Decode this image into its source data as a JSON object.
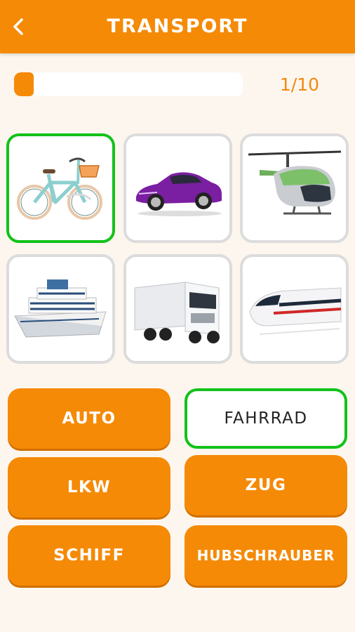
{
  "header": {
    "title": "TRANSPORT",
    "back_icon": "chevron-left-icon"
  },
  "progress": {
    "current": 1,
    "total": 10,
    "label": "1/10",
    "fraction": 0.1
  },
  "colors": {
    "accent": "#f58a07",
    "correct": "#12c21a",
    "background": "#fdf6ee"
  },
  "tiles": [
    {
      "icon": "bicycle-image",
      "selected": true
    },
    {
      "icon": "sports-car-image",
      "selected": false
    },
    {
      "icon": "helicopter-image",
      "selected": false
    },
    {
      "icon": "cruise-ship-image",
      "selected": false
    },
    {
      "icon": "truck-image",
      "selected": false
    },
    {
      "icon": "high-speed-train-image",
      "selected": false
    }
  ],
  "answers": [
    {
      "label": "AUTO",
      "selected": false
    },
    {
      "label": "FAHRRAD",
      "selected": true
    },
    {
      "label": "LKW",
      "selected": false
    },
    {
      "label": "ZUG",
      "selected": false
    },
    {
      "label": "SCHIFF",
      "selected": false
    },
    {
      "label": "HUBSCHRAUBER",
      "selected": false
    }
  ]
}
